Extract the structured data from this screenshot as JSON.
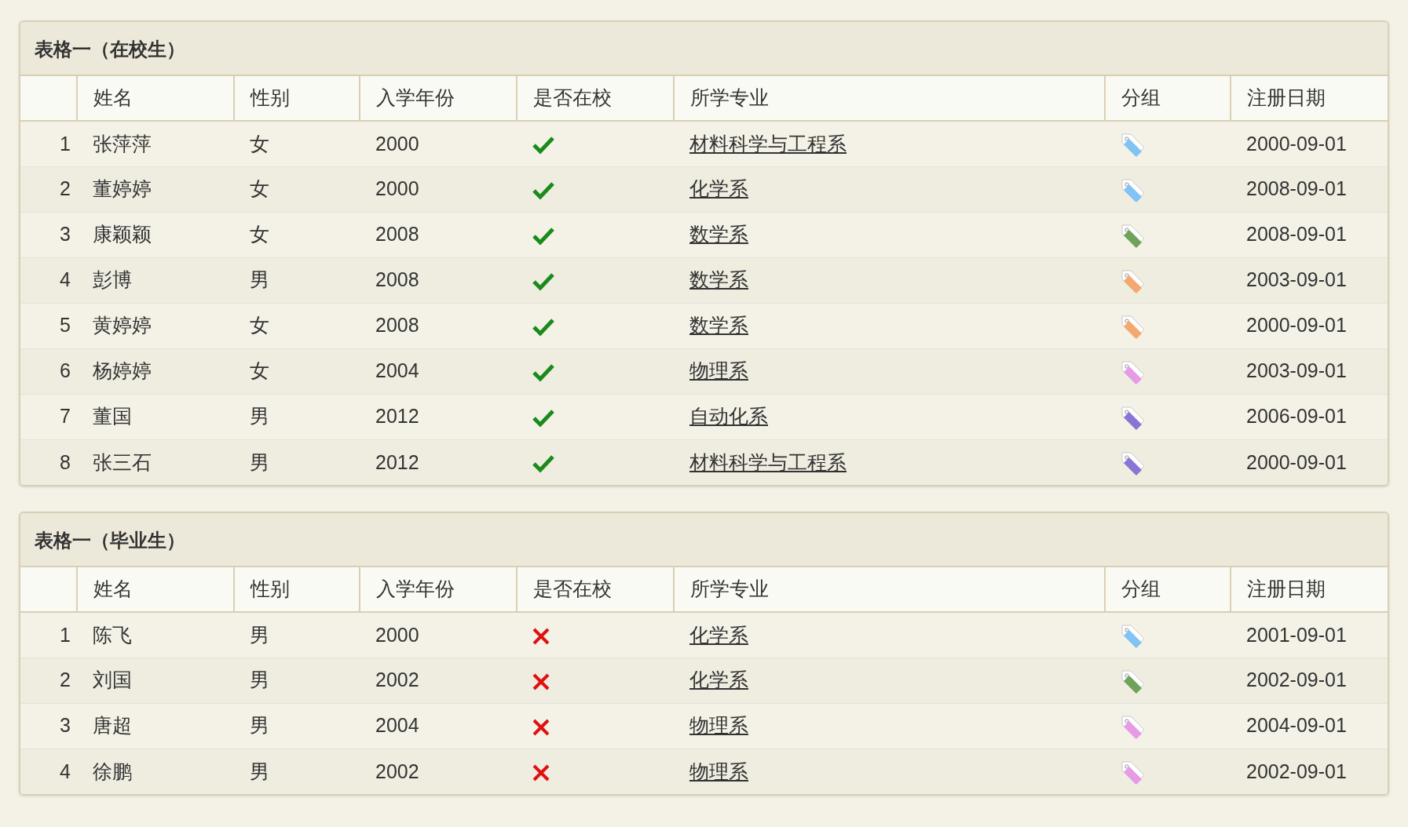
{
  "tables": [
    {
      "title": "表格一（在校生）",
      "columns": [
        "姓名",
        "性别",
        "入学年份",
        "是否在校",
        "所学专业",
        "分组",
        "注册日期"
      ],
      "rows": [
        {
          "index": "1",
          "name": "张萍萍",
          "gender": "女",
          "year": "2000",
          "in_school": true,
          "major": "材料科学与工程系",
          "color": "#7fc4f5",
          "date": "2000-09-01"
        },
        {
          "index": "2",
          "name": "董婷婷",
          "gender": "女",
          "year": "2000",
          "in_school": true,
          "major": "化学系",
          "color": "#7fc4f5",
          "date": "2008-09-01"
        },
        {
          "index": "3",
          "name": "康颖颖",
          "gender": "女",
          "year": "2008",
          "in_school": true,
          "major": "数学系",
          "color": "#6fa35a",
          "date": "2008-09-01"
        },
        {
          "index": "4",
          "name": "彭博",
          "gender": "男",
          "year": "2008",
          "in_school": true,
          "major": "数学系",
          "color": "#f5a86d",
          "date": "2003-09-01"
        },
        {
          "index": "5",
          "name": "黄婷婷",
          "gender": "女",
          "year": "2008",
          "in_school": true,
          "major": "数学系",
          "color": "#f5a86d",
          "date": "2000-09-01"
        },
        {
          "index": "6",
          "name": "杨婷婷",
          "gender": "女",
          "year": "2004",
          "in_school": true,
          "major": "物理系",
          "color": "#e79be6",
          "date": "2003-09-01"
        },
        {
          "index": "7",
          "name": "董国",
          "gender": "男",
          "year": "2012",
          "in_school": true,
          "major": "自动化系",
          "color": "#8a75d6",
          "date": "2006-09-01"
        },
        {
          "index": "8",
          "name": "张三石",
          "gender": "男",
          "year": "2012",
          "in_school": true,
          "major": "材料科学与工程系",
          "color": "#8a75d6",
          "date": "2000-09-01"
        }
      ]
    },
    {
      "title": "表格一（毕业生）",
      "columns": [
        "姓名",
        "性别",
        "入学年份",
        "是否在校",
        "所学专业",
        "分组",
        "注册日期"
      ],
      "rows": [
        {
          "index": "1",
          "name": "陈飞",
          "gender": "男",
          "year": "2000",
          "in_school": false,
          "major": "化学系",
          "color": "#7fc4f5",
          "date": "2001-09-01"
        },
        {
          "index": "2",
          "name": "刘国",
          "gender": "男",
          "year": "2002",
          "in_school": false,
          "major": "化学系",
          "color": "#6fa35a",
          "date": "2002-09-01"
        },
        {
          "index": "3",
          "name": "唐超",
          "gender": "男",
          "year": "2004",
          "in_school": false,
          "major": "物理系",
          "color": "#e79be6",
          "date": "2004-09-01"
        },
        {
          "index": "4",
          "name": "徐鹏",
          "gender": "男",
          "year": "2002",
          "in_school": false,
          "major": "物理系",
          "color": "#e79be6",
          "date": "2002-09-01"
        }
      ]
    }
  ]
}
